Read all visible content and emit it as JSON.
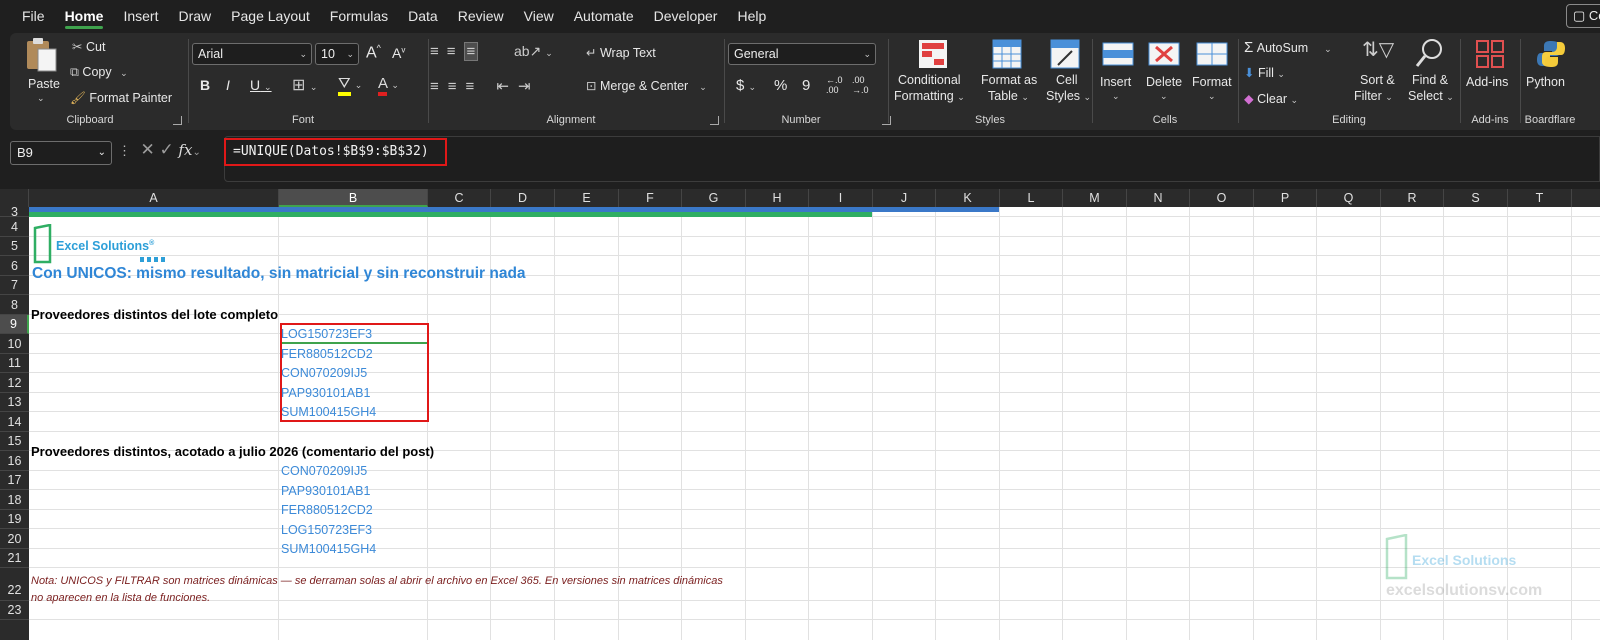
{
  "menu": {
    "items": [
      "File",
      "Home",
      "Insert",
      "Draw",
      "Page Layout",
      "Formulas",
      "Data",
      "Review",
      "View",
      "Automate",
      "Developer",
      "Help"
    ],
    "active": "Home",
    "comments_label": "Co"
  },
  "ribbon": {
    "clipboard": {
      "paste": "Paste",
      "cut": "Cut",
      "copy": "Copy",
      "format_painter": "Format Painter",
      "label": "Clipboard"
    },
    "font": {
      "name": "Arial",
      "size": "10",
      "bold": "B",
      "italic": "I",
      "underline": "U",
      "grow": "A",
      "shrink": "A",
      "label": "Font"
    },
    "alignment": {
      "wrap": "Wrap Text",
      "merge": "Merge & Center",
      "label": "Alignment"
    },
    "number": {
      "format": "General",
      "currency": "$",
      "percent": "%",
      "comma": "9",
      "inc": "←.0 .00",
      "dec": ".00 →.0",
      "label": "Number"
    },
    "styles": {
      "conditional_1": "Conditional",
      "conditional_2": "Formatting",
      "table_1": "Format as",
      "table_2": "Table",
      "cell_1": "Cell",
      "cell_2": "Styles",
      "label": "Styles"
    },
    "cells": {
      "insert": "Insert",
      "delete": "Delete",
      "format": "Format",
      "label": "Cells"
    },
    "editing": {
      "autosum": "AutoSum",
      "fill": "Fill",
      "clear": "Clear",
      "sort_1": "Sort &",
      "sort_2": "Filter",
      "find_1": "Find &",
      "find_2": "Select",
      "label": "Editing"
    },
    "addins": {
      "btn": "Add-ins",
      "label": "Add-ins"
    },
    "python": {
      "btn": "Python",
      "label": "Boardflare"
    }
  },
  "formula_bar": {
    "name_box": "B9",
    "fx": "fx",
    "formula": "=UNIQUE(Datos!$B$9:$B$32)"
  },
  "columns": [
    "A",
    "B",
    "C",
    "D",
    "E",
    "F",
    "G",
    "H",
    "I",
    "J",
    "K",
    "L",
    "M",
    "N",
    "O",
    "P",
    "Q",
    "R",
    "S",
    "T"
  ],
  "rows": [
    "3",
    "4",
    "5",
    "6",
    "7",
    "8",
    "9",
    "10",
    "11",
    "12",
    "13",
    "14",
    "15",
    "16",
    "17",
    "18",
    "19",
    "20",
    "21",
    "22",
    "23"
  ],
  "sheet": {
    "logo_text": "Excel Solutions",
    "logo_reg": "®",
    "title": "Con UNICOS: mismo resultado, sin matricial y sin reconstruir nada",
    "section1": "Proveedores distintos del lote completo",
    "list1": [
      "LOG150723EF3",
      "FER880512CD2",
      "CON070209IJ5",
      "PAP930101AB1",
      "SUM100415GH4"
    ],
    "section2": "Proveedores distintos, acotado a julio 2026 (comentario del post)",
    "list2": [
      "CON070209IJ5",
      "PAP930101AB1",
      "FER880512CD2",
      "LOG150723EF3",
      "SUM100415GH4"
    ],
    "note_1": "Nota: UNICOS y FILTRAR son matrices dinámicas — se derraman solas al abrir el archivo en Excel 365. En versiones sin matrices dinámicas",
    "note_2": "no aparecen en la lista de funciones.",
    "watermark_text": "Excel Solutions",
    "watermark_url": "excelsolutionsv.com"
  },
  "colors": {
    "accent_green": "#3fa34d",
    "highlight_red": "#e01818",
    "value_blue": "#3c8ad8",
    "title_blue": "#2f86d6",
    "note_red": "#7a1e1e"
  }
}
